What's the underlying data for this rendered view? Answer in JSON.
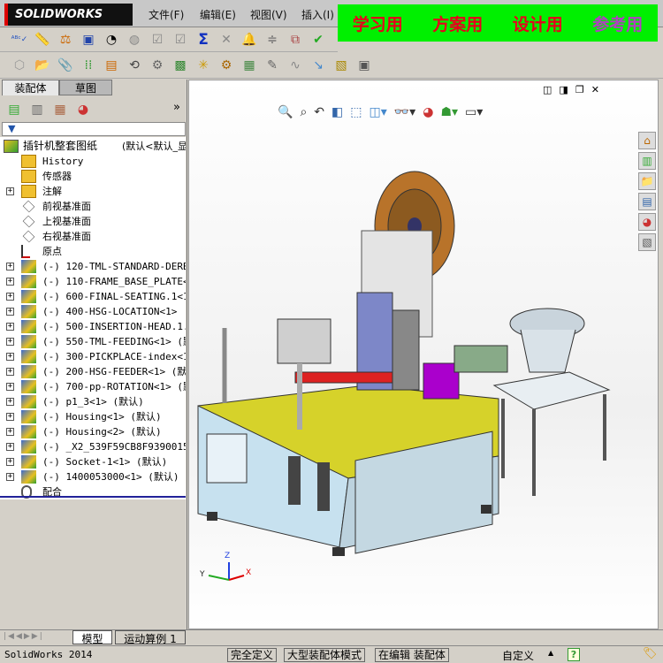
{
  "app": {
    "logo": "SOLIDWORKS",
    "menu": [
      "文件(F)",
      "编辑(E)",
      "视图(V)",
      "插入(I)"
    ]
  },
  "banner": {
    "items": [
      {
        "text": "学习用",
        "color": "#e8001c"
      },
      {
        "text": "方案用",
        "color": "#e8001c"
      },
      {
        "text": "设计用",
        "color": "#e8001c"
      },
      {
        "text": "参考用",
        "color": "#b040c0"
      }
    ],
    "background": "#00f000"
  },
  "toolbar1": [
    "spell-check-icon",
    "measure-icon",
    "mass-properties-icon",
    "section-properties-icon",
    "performance-icon",
    "clearance-icon",
    "checkbox-icon",
    "checkbox-icon",
    "sum-icon",
    "interference-icon",
    "warning-bell-icon",
    "align-icon",
    "compare-icon",
    "check-icon"
  ],
  "toolbar2": [
    "component-icon",
    "insert-component-icon",
    "mate-icon",
    "pattern-icon",
    "smart-fastener-icon",
    "move-component-icon",
    "assembly-features-icon",
    "explode-icon",
    "reference-geometry-icon",
    "motion-icon",
    "bom-icon",
    "sketch-icon",
    "spline-icon",
    "tolerance-icon",
    "snapshot-icon"
  ],
  "panel": {
    "tabs": [
      "装配体",
      "草图"
    ],
    "filter": "filter-icon",
    "expand": "»"
  },
  "tree": {
    "root": {
      "name": "插针机整套图纸",
      "config": "(默认<默认_显"
    },
    "items": [
      {
        "label": "History",
        "type": "history",
        "expand": false
      },
      {
        "label": "传感器",
        "type": "sensor",
        "expand": false
      },
      {
        "label": "注解",
        "type": "annotation",
        "expand": true
      },
      {
        "label": "前视基准面",
        "type": "plane",
        "expand": false
      },
      {
        "label": "上视基准面",
        "type": "plane",
        "expand": false
      },
      {
        "label": "右视基准面",
        "type": "plane",
        "expand": false
      },
      {
        "label": "原点",
        "type": "origin",
        "expand": false
      },
      {
        "label": "(-) 120-TML-STANDARD-DERB",
        "type": "asm",
        "expand": true
      },
      {
        "label": "(-) 110-FRAME_BASE_PLATE<",
        "type": "asm",
        "expand": true
      },
      {
        "label": "(-) 600-FINAL-SEATING.1<1",
        "type": "asm",
        "expand": true
      },
      {
        "label": "(-) 400-HSG-LOCATION<1>",
        "type": "asm",
        "expand": true
      },
      {
        "label": "(-) 500-INSERTION-HEAD.1.",
        "type": "asm",
        "expand": true
      },
      {
        "label": "(-) 550-TML-FEEDING<1> (默",
        "type": "asm",
        "expand": true
      },
      {
        "label": "(-) 300-PICKPLACE-index<1",
        "type": "asm",
        "expand": true
      },
      {
        "label": "(-) 200-HSG-FEEDER<1> (默",
        "type": "asm",
        "expand": true
      },
      {
        "label": "(-) 700-pp-ROTATION<1> (默",
        "type": "asm",
        "expand": true
      },
      {
        "label": "(-) p1_3<1> (默认)",
        "type": "asm",
        "expand": true
      },
      {
        "label": "(-) Housing<1> (默认)",
        "type": "asm",
        "expand": true
      },
      {
        "label": "(-) Housing<2> (默认)",
        "type": "asm",
        "expand": true
      },
      {
        "label": "(-) _X2_539F59CB8F9390015",
        "type": "asm",
        "expand": true
      },
      {
        "label": "(-) Socket-1<1> (默认)",
        "type": "asm",
        "expand": true
      },
      {
        "label": "(-) 1400053000<1> (默认)",
        "type": "asm",
        "expand": true
      },
      {
        "label": "配合",
        "type": "mates",
        "expand": false
      }
    ]
  },
  "bottom_tabs": [
    "模型",
    "运动算例 1"
  ],
  "status": {
    "app": "SolidWorks 2014",
    "fully_defined": "完全定义",
    "large_asm": "大型装配体模式",
    "editing": "在编辑 装配体",
    "units": "自定义",
    "help": "?"
  },
  "triad": {
    "x": "X",
    "y": "Y",
    "z": "Z"
  }
}
